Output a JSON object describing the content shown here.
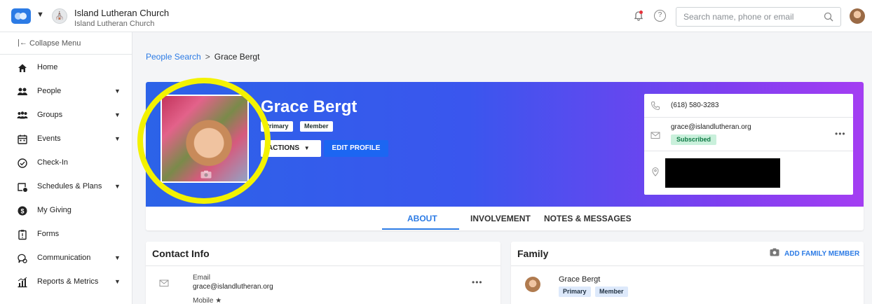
{
  "topbar": {
    "church_name": "Island Lutheran Church",
    "church_sub": "Island Lutheran Church",
    "search_placeholder": "Search name, phone or email"
  },
  "sidebar": {
    "collapse_label": "Collapse Menu",
    "items": [
      {
        "label": "Home",
        "icon": "home-icon",
        "has_caret": false
      },
      {
        "label": "People",
        "icon": "people-icon",
        "has_caret": true
      },
      {
        "label": "Groups",
        "icon": "groups-icon",
        "has_caret": true
      },
      {
        "label": "Events",
        "icon": "calendar-icon",
        "has_caret": true
      },
      {
        "label": "Check-In",
        "icon": "check-circle-icon",
        "has_caret": false
      },
      {
        "label": "Schedules & Plans",
        "icon": "schedule-icon",
        "has_caret": true
      },
      {
        "label": "My Giving",
        "icon": "dollar-icon",
        "has_caret": false
      },
      {
        "label": "Forms",
        "icon": "clipboard-icon",
        "has_caret": false
      },
      {
        "label": "Communication",
        "icon": "chat-icon",
        "has_caret": true
      },
      {
        "label": "Reports & Metrics",
        "icon": "chart-icon",
        "has_caret": true
      }
    ]
  },
  "breadcrumb": {
    "link": "People Search",
    "separator": ">",
    "current": "Grace Bergt"
  },
  "profile": {
    "name": "Grace Bergt",
    "tags": [
      "Primary",
      "Member"
    ],
    "actions_label": "ACTIONS",
    "edit_label": "EDIT PROFILE",
    "phone": "(618) 580-3283",
    "email": "grace@islandlutheran.org",
    "email_status": "Subscribed",
    "tabs": [
      {
        "label": "ABOUT",
        "active": true
      },
      {
        "label": "INVOLVEMENT",
        "active": false
      },
      {
        "label": "NOTES & MESSAGES",
        "active": false
      }
    ]
  },
  "contact_info": {
    "title": "Contact Info",
    "email_label": "Email",
    "email_value": "grace@islandlutheran.org",
    "mobile_label": "Mobile ★"
  },
  "family": {
    "title": "Family",
    "add_label": "ADD FAMILY MEMBER",
    "member_name": "Grace Bergt",
    "member_tags": [
      "Primary",
      "Member"
    ]
  },
  "colors": {
    "accent": "#2c7be5",
    "banner_start": "#2c63e8",
    "banner_end": "#a43ef2",
    "highlight": "#f3f200"
  }
}
